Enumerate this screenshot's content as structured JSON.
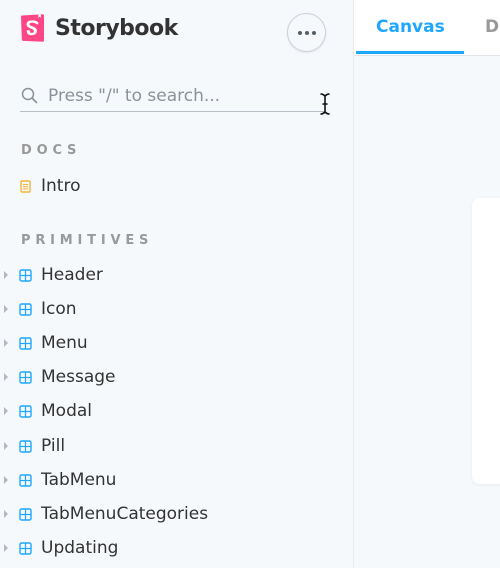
{
  "brand": {
    "name": "Storybook",
    "logo_icon": "storybook-logo-icon",
    "color": "#ff4785"
  },
  "menu_button": {
    "icon": "ellipsis-icon"
  },
  "search": {
    "placeholder": "Press \"/\" to search...",
    "value": ""
  },
  "sidebar": {
    "sections": [
      {
        "heading": "DOCS",
        "items": [
          {
            "label": "Intro",
            "icon": "document-icon",
            "expandable": false
          }
        ]
      },
      {
        "heading": "PRIMITIVES",
        "items": [
          {
            "label": "Header",
            "icon": "component-icon",
            "expandable": true
          },
          {
            "label": "Icon",
            "icon": "component-icon",
            "expandable": true
          },
          {
            "label": "Menu",
            "icon": "component-icon",
            "expandable": true
          },
          {
            "label": "Message",
            "icon": "component-icon",
            "expandable": true
          },
          {
            "label": "Modal",
            "icon": "component-icon",
            "expandable": true
          },
          {
            "label": "Pill",
            "icon": "component-icon",
            "expandable": true
          },
          {
            "label": "TabMenu",
            "icon": "component-icon",
            "expandable": true
          },
          {
            "label": "TabMenuCategories",
            "icon": "component-icon",
            "expandable": true
          },
          {
            "label": "Updating",
            "icon": "component-icon",
            "expandable": true
          }
        ]
      }
    ]
  },
  "toolbar": {
    "tabs": [
      {
        "label": "Canvas",
        "active": true
      },
      {
        "label": "D",
        "active": false
      }
    ],
    "accent": "#1ea7fd"
  },
  "colors": {
    "docs_icon": "#f4b63c",
    "component_icon": "#1ea7fd",
    "section_heading": "#999999",
    "text": "#333333"
  }
}
